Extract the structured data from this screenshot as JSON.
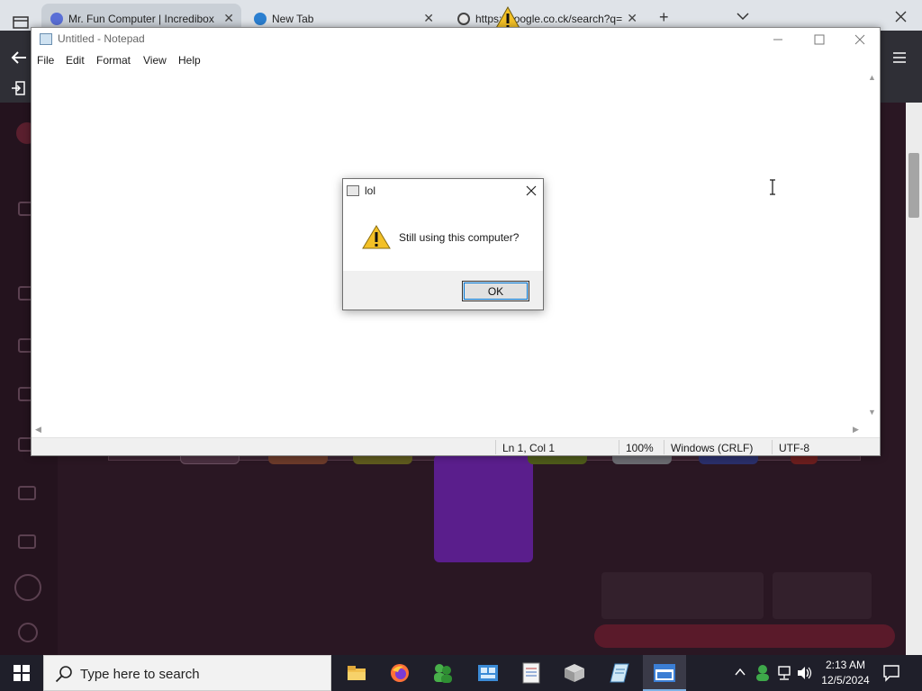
{
  "browser": {
    "tabs": [
      {
        "label": "Mr. Fun Computer | Incredibox",
        "active": true
      },
      {
        "label": "New Tab",
        "active": false
      },
      {
        "label": "https://google.co.ck/search?q=",
        "active": false
      }
    ],
    "new_tab_symbol": "+",
    "tab_close_symbol": "✕"
  },
  "notepad": {
    "title": "Untitled - Notepad",
    "menu": [
      "File",
      "Edit",
      "Format",
      "View",
      "Help"
    ],
    "status": {
      "position": "Ln 1, Col 1",
      "zoom": "100%",
      "line_ending": "Windows (CRLF)",
      "encoding": "UTF-8"
    }
  },
  "dialog": {
    "title": "lol",
    "message": "Still using this computer?",
    "ok_label": "OK"
  },
  "taskbar": {
    "search_placeholder": "Type here to search",
    "time": "2:13 AM",
    "date": "12/5/2024"
  },
  "icons": {
    "windows": "windows-logo-icon",
    "search": "search-icon",
    "warning": "warning-icon",
    "close": "close-icon"
  },
  "colors": {
    "taskbar": "#1f1f2a",
    "accent": "#0078d7",
    "warning_yellow": "#f3c026",
    "page_background": "#2a1723"
  }
}
